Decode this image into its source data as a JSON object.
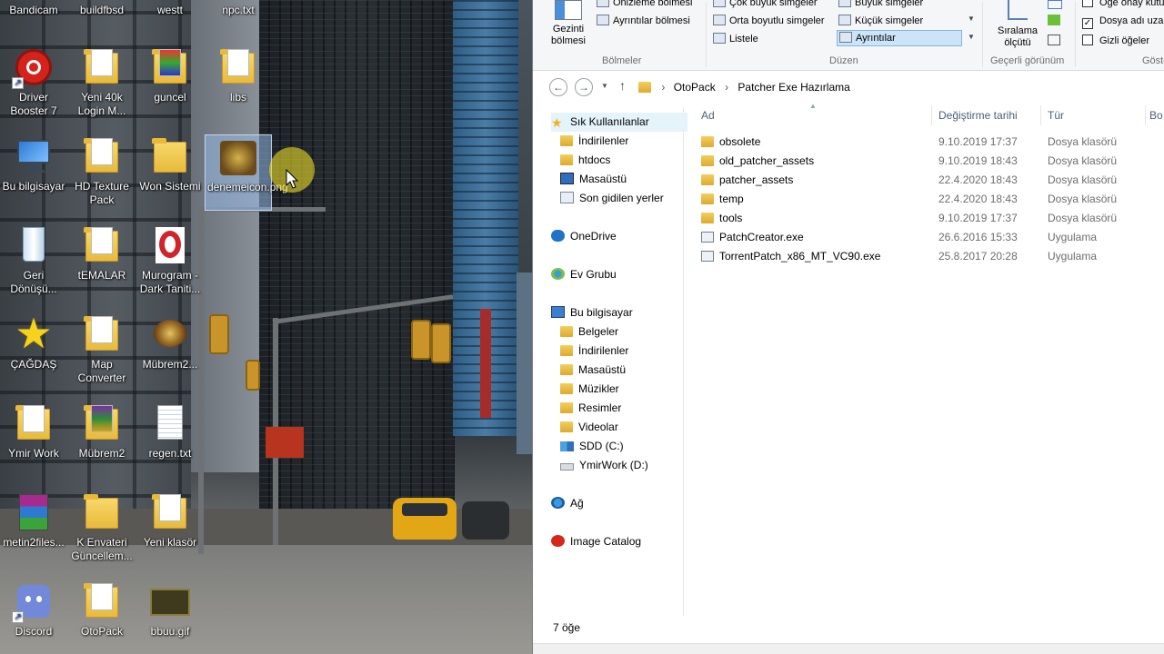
{
  "desktop": {
    "icons": [
      {
        "label": "Bandicam"
      },
      {
        "label": "buildfbsd"
      },
      {
        "label": "westt"
      },
      {
        "label": "npc.txt"
      },
      {
        "label": "Driver Booster 7"
      },
      {
        "label": "Yeni 40k Login M..."
      },
      {
        "label": "guncel"
      },
      {
        "label": "libs"
      },
      {
        "label": "Bu bilgisayar"
      },
      {
        "label": "HD Texture Pack"
      },
      {
        "label": "Won Sistemi"
      },
      {
        "label": "denemeicon.png"
      },
      {
        "label": "Geri Dönüşü..."
      },
      {
        "label": "tEMALAR"
      },
      {
        "label": "Murogram - Dark Taniti..."
      },
      {
        "label": "ÇAĞDAŞ"
      },
      {
        "label": "Map Converter"
      },
      {
        "label": "Mübrem2..."
      },
      {
        "label": "Ymir Work"
      },
      {
        "label": "Mübrem2"
      },
      {
        "label": "regen.txt"
      },
      {
        "label": "metin2files..."
      },
      {
        "label": "K Envateri Güncellem..."
      },
      {
        "label": "Yeni klasör"
      },
      {
        "label": "Discord"
      },
      {
        "label": "OtoPack"
      },
      {
        "label": "bbuu.gif"
      }
    ],
    "selected_icon": "denemeicon.png"
  },
  "ribbon": {
    "panes": {
      "nav_pane": "Gezinti bölmesi",
      "preview_pane": "Önizleme bölmesi",
      "details_pane": "Ayrıntılar bölmesi",
      "group_label": "Bölmeler"
    },
    "layout": {
      "items": [
        "Çok büyük simgeler",
        "Büyük simgeler",
        "Orta boyutlu simgeler",
        "Küçük simgeler",
        "Listele",
        "Ayrıntılar"
      ],
      "selected": "Ayrıntılar",
      "group_label": "Düzen"
    },
    "current_view": {
      "sort_by": "Sıralama ölçütü",
      "group_label": "Geçerli görünüm"
    },
    "show_hide": {
      "item_checkboxes": "Öğe onay kutu",
      "file_name_extensions": "Dosya adı uza",
      "hidden_items": "Gizli öğeler",
      "item_checkboxes_checked": false,
      "file_name_extensions_checked": true,
      "hidden_items_checked": false,
      "group_label": "Göste"
    }
  },
  "address": {
    "crumbs": [
      "OtoPack",
      "Patcher Exe Hazırlama"
    ],
    "separator": "›"
  },
  "nav": {
    "items": [
      {
        "label": "Sık Kullanılanlar",
        "icon": "star-icon"
      },
      {
        "label": "İndirilenler",
        "icon": "download-folder-icon"
      },
      {
        "label": "htdocs",
        "icon": "folder-icon"
      },
      {
        "label": "Masaüstü",
        "icon": "desktop-icon"
      },
      {
        "label": "Son gidilen yerler",
        "icon": "recent-icon"
      },
      {
        "label": "OneDrive",
        "icon": "cloud-icon"
      },
      {
        "label": "Ev Grubu",
        "icon": "homegroup-icon"
      },
      {
        "label": "Bu bilgisayar",
        "icon": "computer-icon"
      },
      {
        "label": "Belgeler",
        "icon": "documents-icon"
      },
      {
        "label": "İndirilenler",
        "icon": "download-folder-icon"
      },
      {
        "label": "Masaüstü",
        "icon": "desktop-icon"
      },
      {
        "label": "Müzikler",
        "icon": "music-icon"
      },
      {
        "label": "Resimler",
        "icon": "pictures-icon"
      },
      {
        "label": "Videolar",
        "icon": "videos-icon"
      },
      {
        "label": "SDD (C:)",
        "icon": "drive-c-icon"
      },
      {
        "label": "YmirWork (D:)",
        "icon": "drive-d-icon"
      },
      {
        "label": "Ağ",
        "icon": "network-icon"
      },
      {
        "label": "Image Catalog",
        "icon": "image-catalog-icon"
      }
    ]
  },
  "files": {
    "columns": {
      "name": "Ad",
      "date": "Değiştirme tarihi",
      "type": "Tür",
      "size": "Bo"
    },
    "rows": [
      {
        "name": "obsolete",
        "date": "9.10.2019 17:37",
        "type": "Dosya klasörü",
        "icon": "folder-icon"
      },
      {
        "name": "old_patcher_assets",
        "date": "9.10.2019 18:43",
        "type": "Dosya klasörü",
        "icon": "folder-icon"
      },
      {
        "name": "patcher_assets",
        "date": "22.4.2020 18:43",
        "type": "Dosya klasörü",
        "icon": "folder-icon"
      },
      {
        "name": "temp",
        "date": "22.4.2020 18:43",
        "type": "Dosya klasörü",
        "icon": "folder-icon"
      },
      {
        "name": "tools",
        "date": "9.10.2019 17:37",
        "type": "Dosya klasörü",
        "icon": "folder-icon"
      },
      {
        "name": "PatchCreator.exe",
        "date": "26.6.2016 15:33",
        "type": "Uygulama",
        "icon": "exe-icon"
      },
      {
        "name": "TorrentPatch_x86_MT_VC90.exe",
        "date": "25.8.2017 20:28",
        "type": "Uygulama",
        "icon": "exe-icon"
      }
    ]
  },
  "status": {
    "count": "7 öğe"
  }
}
